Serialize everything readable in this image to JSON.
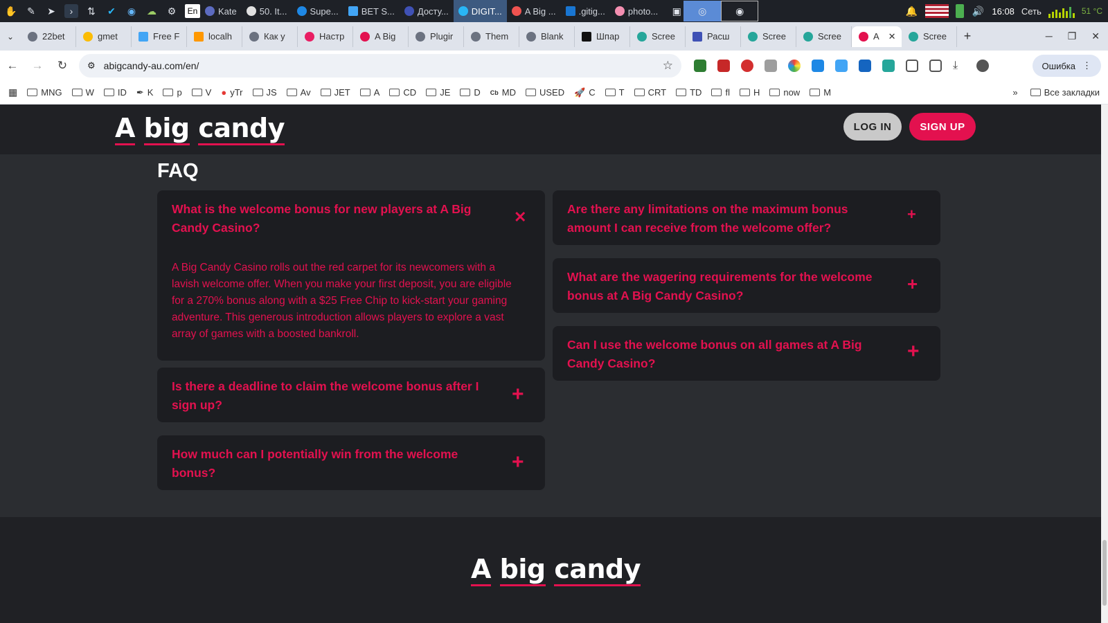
{
  "taskbar": {
    "tasks": [
      {
        "label": "Kate",
        "color": "#5c6bc0"
      },
      {
        "label": "50. It...",
        "color": "#e0e0e0"
      },
      {
        "label": "Supe...",
        "color": "#1e88e5"
      },
      {
        "label": "BET S...",
        "color": "#42a5f5"
      },
      {
        "label": "Досту...",
        "color": "#3f51b5"
      },
      {
        "label": "DIGIT...",
        "color": "#29b6f6"
      },
      {
        "label": "A Big ...",
        "color": "#ef5350"
      },
      {
        "label": ".gitig...",
        "color": "#1976d2"
      },
      {
        "label": "photo...",
        "color": "#f48fb1"
      }
    ],
    "lang": "En",
    "clock": "16:08",
    "network": "Сеть",
    "temp": "51 °C"
  },
  "tabs": [
    {
      "label": "22bet"
    },
    {
      "label": "gmet"
    },
    {
      "label": "Free F"
    },
    {
      "label": "localh"
    },
    {
      "label": "Как у"
    },
    {
      "label": "Настр"
    },
    {
      "label": "A Big"
    },
    {
      "label": "Plugir"
    },
    {
      "label": "Them"
    },
    {
      "label": "Blank"
    },
    {
      "label": "Шпар"
    },
    {
      "label": "Scree"
    },
    {
      "label": "Расш"
    },
    {
      "label": "Scree"
    },
    {
      "label": "Scree"
    },
    {
      "label": "A"
    },
    {
      "label": "Scree"
    }
  ],
  "address": {
    "url": "abigcandy-au.com/en/",
    "error_label": "Ошибка"
  },
  "bookmarks": [
    {
      "label": "MNG"
    },
    {
      "label": "W"
    },
    {
      "label": "ID"
    },
    {
      "label": "K"
    },
    {
      "label": "p"
    },
    {
      "label": "V"
    },
    {
      "label": "yTr"
    },
    {
      "label": "JS"
    },
    {
      "label": "Av"
    },
    {
      "label": "JET"
    },
    {
      "label": "A"
    },
    {
      "label": "CD"
    },
    {
      "label": "JE"
    },
    {
      "label": "D"
    },
    {
      "label": "MD"
    },
    {
      "label": "USED"
    },
    {
      "label": "C"
    },
    {
      "label": "T"
    },
    {
      "label": "CRT"
    },
    {
      "label": "TD"
    },
    {
      "label": "fl"
    },
    {
      "label": "H"
    },
    {
      "label": "now"
    },
    {
      "label": "M"
    }
  ],
  "bookmarks_all": "Все закладки",
  "site": {
    "logo": {
      "a": "A",
      "big": "big",
      "candy": "candy"
    },
    "login": "LOG IN",
    "signup": "SIGN UP",
    "faq_title": "FAQ",
    "brand_color": "#e3114f",
    "faq": [
      {
        "question": "What is the welcome bonus for new players at A Big Candy Casino?",
        "answer": "A Big Candy Casino rolls out the red carpet for its newcomers with a lavish welcome offer. When you make your first deposit, you are eligible for a 270% bonus along with a $25 Free Chip to kick-start your gaming adventure. This generous introduction allows players to explore a vast array of games with a boosted bankroll.",
        "expanded": true,
        "toggle": "✕"
      },
      {
        "question": "Is there a deadline to claim the welcome bonus after I sign up?",
        "toggle": "+"
      },
      {
        "question": "How much can I potentially win from the welcome bonus?",
        "toggle": "+"
      },
      {
        "question": "Are there any limitations on the maximum bonus amount I can receive from the welcome offer?",
        "toggle": "+"
      },
      {
        "question": "What are the wagering requirements for the welcome bonus at A Big Candy Casino?",
        "toggle": "+"
      },
      {
        "question": "Can I use the welcome bonus on all games at A Big Candy Casino?",
        "toggle": "+"
      }
    ]
  }
}
